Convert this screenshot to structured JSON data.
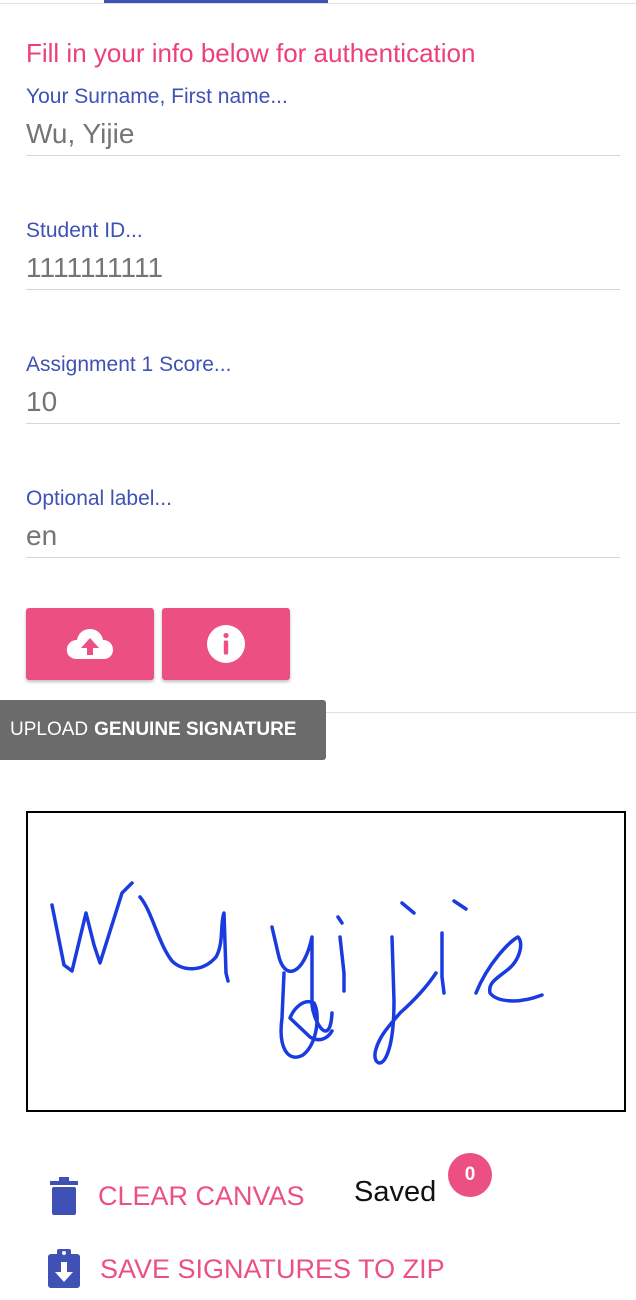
{
  "form": {
    "heading": "Fill in your info below for authentication",
    "fields": [
      {
        "label": "Your Surname, First name...",
        "value": "Wu, Yijie"
      },
      {
        "label": "Student ID...",
        "value": "1111111111"
      },
      {
        "label": "Assignment 1 Score...",
        "value": "10"
      },
      {
        "label": "Optional label...",
        "value": "en"
      }
    ]
  },
  "buttons": {
    "upload_icon": "cloud-upload-icon",
    "info_icon": "info-icon"
  },
  "tooltip": {
    "prefix": "UPLOAD",
    "bold": "GENUINE SIGNATURE"
  },
  "signature": {
    "stroke_color": "#1a3be0"
  },
  "actions": {
    "clear_label": "CLEAR CANVAS",
    "clear_icon": "trash-icon",
    "save_label": "SAVE SIGNATURES TO ZIP",
    "save_icon": "clipboard-download-icon"
  },
  "status": {
    "saved_label": "Saved",
    "saved_count": "0"
  },
  "colors": {
    "accent_pink": "#ec5083",
    "primary_indigo": "#3f51b5",
    "tooltip_gray": "#6b6b6b"
  }
}
